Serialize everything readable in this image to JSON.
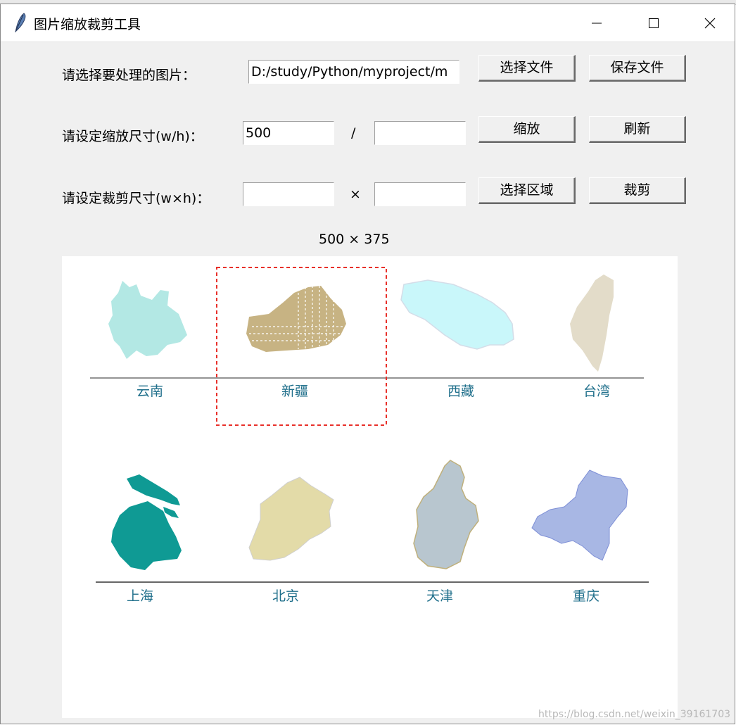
{
  "window": {
    "title": "图片缩放裁剪工具",
    "controls": [
      "minimize",
      "maximize",
      "close"
    ]
  },
  "form": {
    "select_label": "请选择要处理的图片：",
    "file_path": "D:/study/Python/myproject/m",
    "select_file_button": "选择文件",
    "save_file_button": "保存文件",
    "scale_label": "请设定缩放尺寸(w/h)：",
    "scale_width": "500",
    "scale_height": "",
    "scale_separator": "/",
    "scale_button": "缩放",
    "refresh_button": "刷新",
    "crop_label": "请设定裁剪尺寸(w×h)：",
    "crop_width": "",
    "crop_height": "",
    "crop_separator": "×",
    "select_region_button": "选择区域",
    "crop_button": "裁剪"
  },
  "image_size": "500 × 375",
  "image": {
    "top_row": [
      "云南",
      "新疆",
      "西藏",
      "台湾"
    ],
    "bottom_row": [
      "上海",
      "北京",
      "天津",
      "重庆"
    ],
    "colors": {
      "yunnan": "#b3e8e4",
      "xinjiang": "#c7b383",
      "xizang": "#c9f7fa",
      "taiwan": "#e3dcc9",
      "shanghai": "#0f9a94",
      "beijing": "#e3dba8",
      "tianjin": "#b8c6cf",
      "chongqing": "#a8b7e4",
      "selection": "#e8302a"
    }
  },
  "watermark": "https://blog.csdn.net/weixin_39161703"
}
